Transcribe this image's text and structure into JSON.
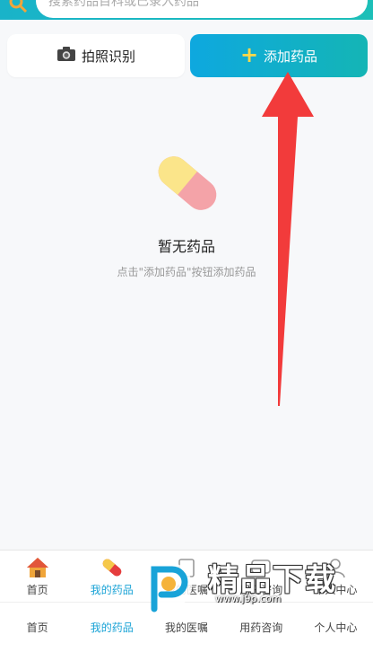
{
  "search": {
    "placeholder": "搜索药品百科或已录入药品"
  },
  "actions": {
    "photo_label": "拍照识别",
    "add_label": "添加药品"
  },
  "empty": {
    "title": "暂无药品",
    "hint": "点击\"添加药品\"按钮添加药品"
  },
  "tabbar": {
    "items": [
      {
        "label": "首页",
        "icon": "home-icon"
      },
      {
        "label": "我的药品",
        "icon": "pill-icon",
        "active": true
      },
      {
        "label": "我的医嘱",
        "icon": "doctor-icon"
      },
      {
        "label": "用药咨询",
        "icon": "chat-icon"
      },
      {
        "label": "个人中心",
        "icon": "user-icon"
      }
    ]
  },
  "tabbar_text": {
    "items": [
      {
        "label": "首页"
      },
      {
        "label": "我的药品",
        "active": true
      },
      {
        "label": "我的医嘱"
      },
      {
        "label": "用药咨询"
      },
      {
        "label": "个人中心"
      }
    ]
  },
  "watermark": {
    "text": "精品下载",
    "url": "www.j9p.com"
  },
  "colors": {
    "accent": "#1aa3d6",
    "annotation_arrow": "#f23b3b"
  }
}
